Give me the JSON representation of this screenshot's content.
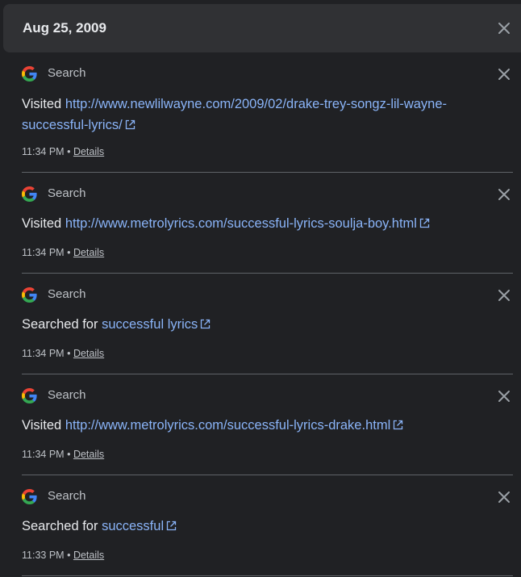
{
  "header": {
    "date": "Aug 25, 2009"
  },
  "entries": [
    {
      "product": "Search",
      "prefix": "Visited",
      "link_text": "http://www.newlilwayne.com/2009/02/drake-trey-songz-lil-wayne-successful-lyrics/",
      "time": "11:34 PM",
      "separator": "•",
      "details_label": "Details"
    },
    {
      "product": "Search",
      "prefix": "Visited",
      "link_text": "http://www.metrolyrics.com/successful-lyrics-soulja-boy.html",
      "time": "11:34 PM",
      "separator": "•",
      "details_label": "Details"
    },
    {
      "product": "Search",
      "prefix": "Searched for",
      "link_text": "successful lyrics",
      "time": "11:34 PM",
      "separator": "•",
      "details_label": "Details"
    },
    {
      "product": "Search",
      "prefix": "Visited",
      "link_text": "http://www.metrolyrics.com/successful-lyrics-drake.html",
      "time": "11:34 PM",
      "separator": "•",
      "details_label": "Details"
    },
    {
      "product": "Search",
      "prefix": "Searched for",
      "link_text": "successful",
      "time": "11:33 PM",
      "separator": "•",
      "details_label": "Details"
    }
  ],
  "colors": {
    "background": "#202124",
    "header_background": "#303134",
    "link": "#8ab4f8",
    "text": "#e8eaed",
    "secondary_text": "#bdc1c6",
    "divider": "#5f6368"
  },
  "icons": {
    "product_icon": "google-g-icon",
    "close_icon": "close-icon",
    "external_link_icon": "external-link-icon"
  }
}
